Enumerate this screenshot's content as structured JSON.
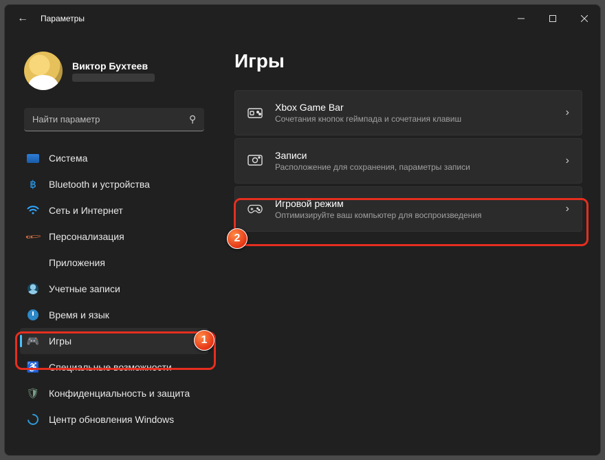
{
  "window": {
    "title": "Параметры"
  },
  "user": {
    "name": "Виктор Бухтеев"
  },
  "search": {
    "placeholder": "Найти параметр"
  },
  "sidebar": {
    "items": [
      {
        "label": "Система"
      },
      {
        "label": "Bluetooth и устройства"
      },
      {
        "label": "Сеть и Интернет"
      },
      {
        "label": "Персонализация"
      },
      {
        "label": "Приложения"
      },
      {
        "label": "Учетные записи"
      },
      {
        "label": "Время и язык"
      },
      {
        "label": "Игры"
      },
      {
        "label": "Специальные возможности"
      },
      {
        "label": "Конфиденциальность и защита"
      },
      {
        "label": "Центр обновления Windows"
      }
    ],
    "active_index": 7
  },
  "page": {
    "title": "Игры",
    "cards": [
      {
        "title": "Xbox Game Bar",
        "subtitle": "Сочетания кнопок геймпада и сочетания клавиш"
      },
      {
        "title": "Записи",
        "subtitle": "Расположение для сохранения, параметры записи"
      },
      {
        "title": "Игровой режим",
        "subtitle": "Оптимизируйте ваш компьютер для воспроизведения"
      }
    ]
  },
  "annotations": {
    "marker1": "1",
    "marker2": "2"
  }
}
